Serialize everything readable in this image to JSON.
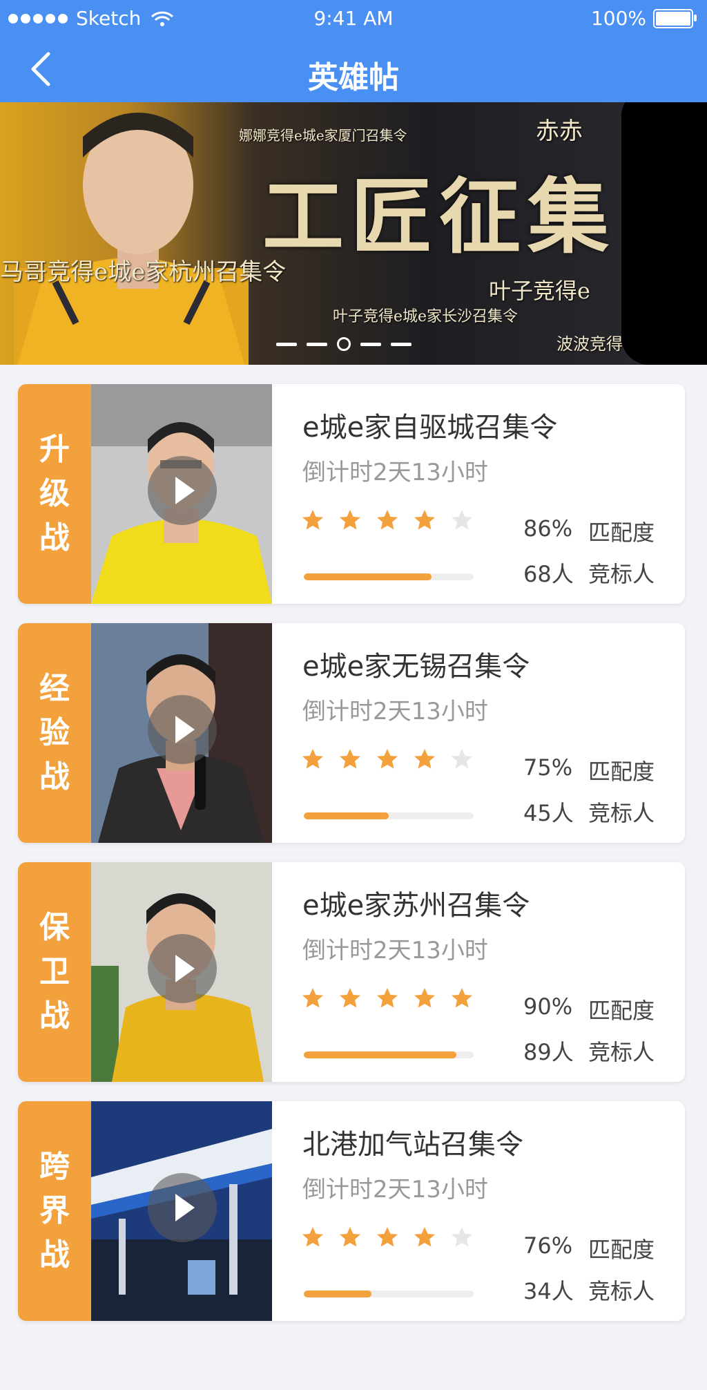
{
  "status_bar": {
    "carrier": "Sketch",
    "time": "9:41 AM",
    "battery": "100%"
  },
  "nav": {
    "title": "英雄帖"
  },
  "banner": {
    "title": "工匠征集",
    "captions": [
      "娜娜竞得e城e家厦门召集令",
      "赤赤",
      "马哥竞得e城e家杭州召集令",
      "叶子竞得e",
      "叶子竞得e城e家长沙召集令",
      "波波竞得e城e家"
    ],
    "page_count": 5,
    "active_page": 3
  },
  "cards": [
    {
      "tag": [
        "升",
        "级",
        "战"
      ],
      "name": "e城e家自驱城召集令",
      "countdown": "倒计时2天13小时",
      "stars": 4,
      "match_value": "86%",
      "match_label": "匹配度",
      "bidders_value": "68人",
      "bidders_label": "竞标人",
      "progress": 0.75,
      "thumb": "worker-yellow-jacket"
    },
    {
      "tag": [
        "经",
        "验",
        "战"
      ],
      "name": "e城e家无锡召集令",
      "countdown": "倒计时2天13小时",
      "stars": 4,
      "match_value": "75%",
      "match_label": "匹配度",
      "bidders_value": "45人",
      "bidders_label": "竞标人",
      "progress": 0.5,
      "thumb": "speaker-with-mic"
    },
    {
      "tag": [
        "保",
        "卫",
        "战"
      ],
      "name": "e城e家苏州召集令",
      "countdown": "倒计时2天13小时",
      "stars": 5,
      "match_value": "90%",
      "match_label": "匹配度",
      "bidders_value": "89人",
      "bidders_label": "竞标人",
      "progress": 0.9,
      "thumb": "worker-yellow-jacket"
    },
    {
      "tag": [
        "跨",
        "界",
        "战"
      ],
      "name": "北港加气站召集令",
      "countdown": "倒计时2天13小时",
      "stars": 4,
      "match_value": "76%",
      "match_label": "匹配度",
      "bidders_value": "34人",
      "bidders_label": "竞标人",
      "progress": 0.4,
      "thumb": "gas-station-night"
    }
  ],
  "colors": {
    "nav_blue": "#4a90f2",
    "accent_orange": "#f3a13c",
    "star_empty": "#e6e6e6"
  }
}
